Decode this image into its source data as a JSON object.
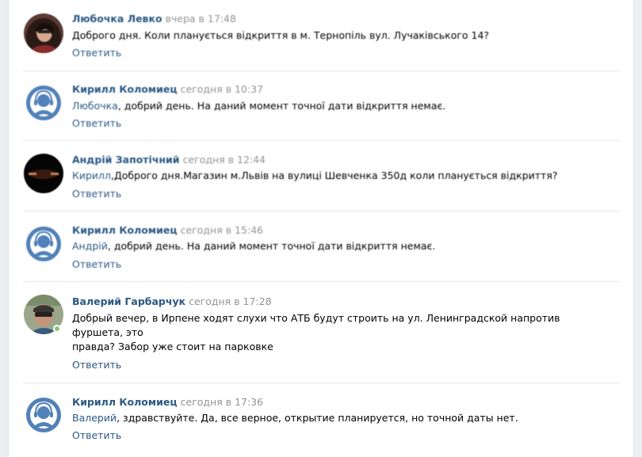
{
  "comments": [
    {
      "author": "Любочка Левко",
      "time": "вчера в 17:48",
      "reply_to": "",
      "text": "Доброго дня. Коли планується відкриття в м. Тернопіль вул. Лучаківського 14?",
      "reply_label": "Ответить",
      "avatar": "woman-photo-avatar"
    },
    {
      "author": "Кирилл Коломиец",
      "time": "сегодня в 10:37",
      "reply_to": "Любочка",
      "text": ", добрий день. На даний момент точної дати відкриття немає.",
      "reply_label": "Ответить",
      "avatar": "headset-operator-avatar"
    },
    {
      "author": "Андрій Запотічний",
      "time": "сегодня в 12:44",
      "reply_to": "Кирилл",
      "text": ",Доброго дня.Магазин м.Львів на вулиці Шевченка 350д коли планується відкриття?",
      "reply_label": "Ответить",
      "avatar": "dark-photo-avatar"
    },
    {
      "author": "Кирилл Коломиец",
      "time": "сегодня в 15:46",
      "reply_to": "Андрій",
      "text": ", добрий день. На даний момент точної дати відкриття немає.",
      "reply_label": "Ответить",
      "avatar": "headset-operator-avatar"
    },
    {
      "author": "Валерий Гарбарчук",
      "time": "сегодня в 17:28",
      "reply_to": "",
      "text_line1": "Добрый вечер, в Ирпене ходят слухи что АТБ будут строить на ул. Ленинградской напротив фуршета, это",
      "text_line2": "правда? Забор уже стоит на парковке",
      "text_line3": ".",
      "reply_label": "Ответить",
      "avatar": "man-sunglasses-photo-avatar",
      "online": true
    },
    {
      "author": "Кирилл Коломиец",
      "time": "сегодня в 17:36",
      "reply_to": "Валерий",
      "text": ", здравствуйте. Да, все верное, открытие планируется, но точной даты нет.",
      "reply_label": "Ответить",
      "avatar": "headset-operator-avatar"
    }
  ],
  "colors": {
    "link": "#2a5885",
    "muted": "#939393",
    "background": "#edeef0",
    "operator_avatar": "#5181b8",
    "online": "#8ac176"
  }
}
